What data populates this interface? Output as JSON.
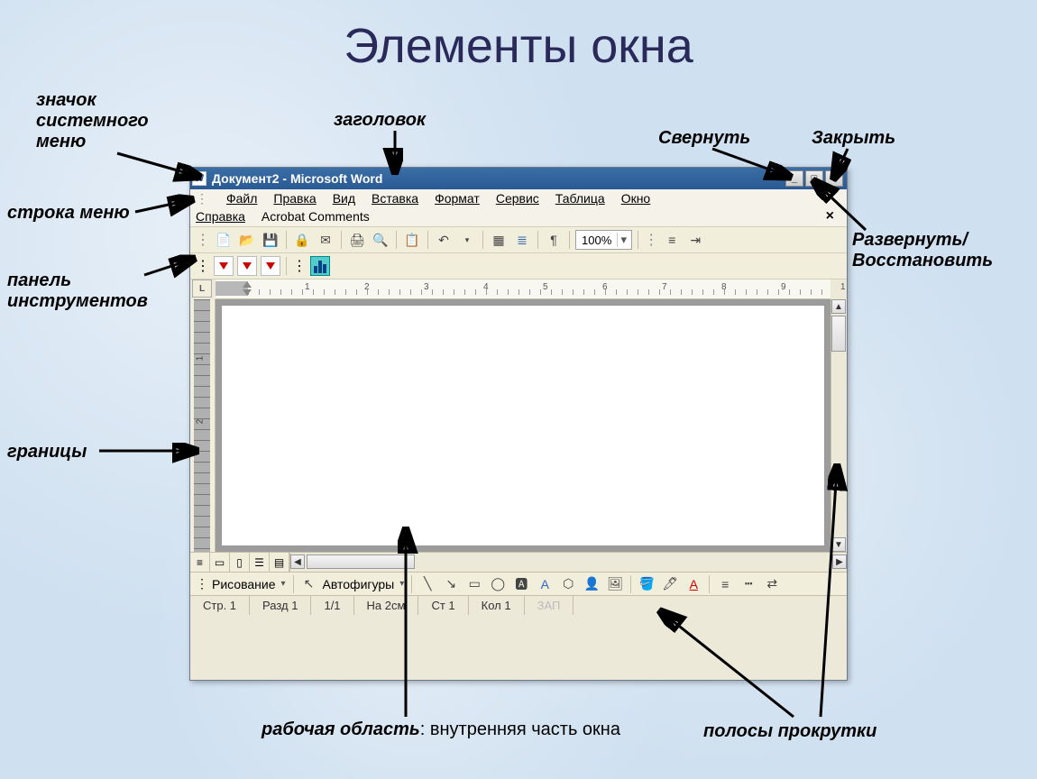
{
  "slide_title": "Элементы окна",
  "callouts": {
    "system_icon": "значок системного меню",
    "title": "заголовок",
    "minimize": "Свернуть",
    "close": "Закрыть",
    "menu_row": "строка меню",
    "toolbar": "панель инструментов",
    "restore": "Развернуть/ Восстановить",
    "borders": "границы",
    "work_area_bold": "рабочая область",
    "work_area_rest": ": внутренняя часть окна",
    "scrollbars": "полосы прокрутки"
  },
  "window": {
    "title": "Документ2 - Microsoft Word",
    "menu": {
      "file": "Файл",
      "edit": "Правка",
      "view": "Вид",
      "insert": "Вставка",
      "format": "Формат",
      "service": "Сервис",
      "table": "Таблица",
      "window": "Окно",
      "help": "Справка",
      "acrobat": "Acrobat Comments"
    },
    "zoom": "100%",
    "ruler_numbers": [
      "1",
      "2",
      "3",
      "4",
      "5",
      "6",
      "7",
      "8",
      "9",
      "1"
    ],
    "vruler_numbers": [
      "1",
      "2"
    ],
    "drawbar": {
      "drawing": "Рисование",
      "autoshapes": "Автофигуры"
    },
    "status": {
      "page": "Стр. 1",
      "section": "Разд 1",
      "pages": "1/1",
      "at": "На 2см",
      "line": "Ст 1",
      "col": "Кол 1",
      "rec": "ЗАП"
    }
  }
}
